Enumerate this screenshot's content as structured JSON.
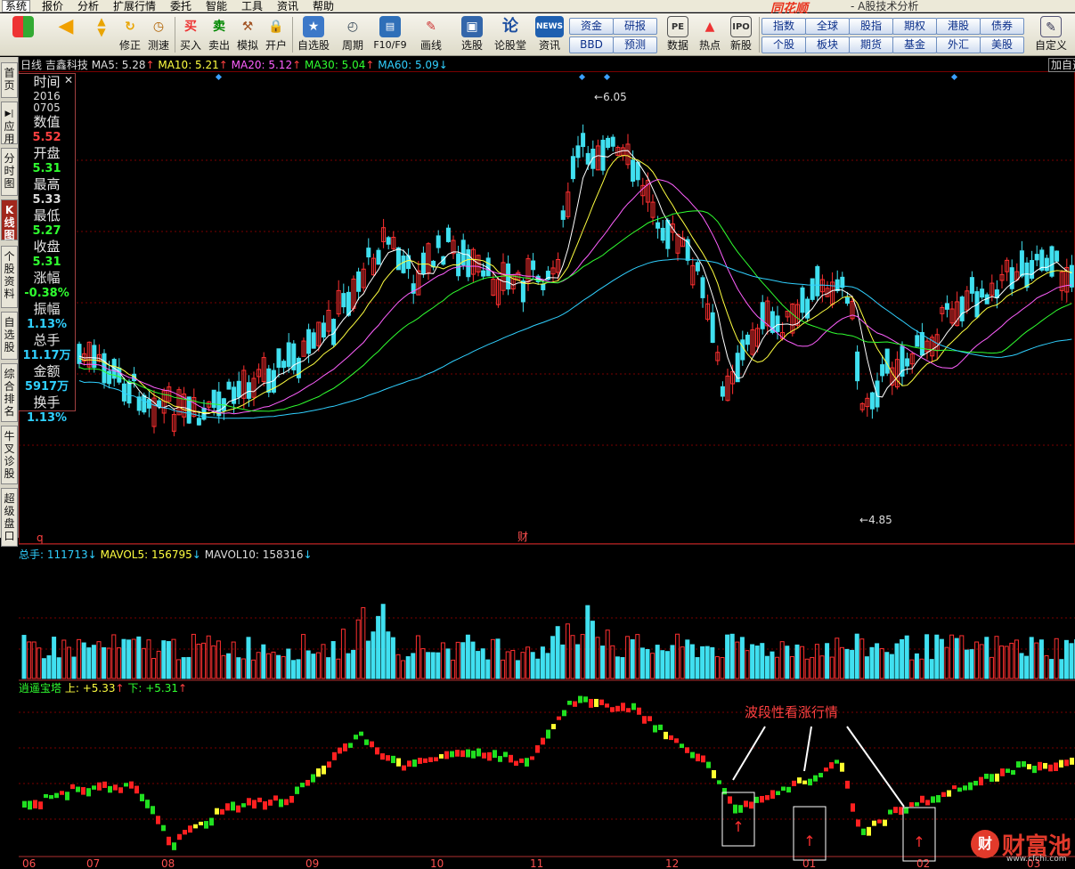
{
  "menu": {
    "items": [
      "系统",
      "报价",
      "分析",
      "扩展行情",
      "委托",
      "智能",
      "工具",
      "资讯",
      "帮助"
    ],
    "active_index": 0,
    "brand": "同花顺",
    "subtitle": "- A股技术分析"
  },
  "toolbar": {
    "buttons": [
      {
        "label": "",
        "icon": "windows-logo-icon"
      },
      {
        "label": "",
        "icon": "back-arrow-icon"
      },
      {
        "label": "修正",
        "icon": "up-down-arrow-icon"
      },
      {
        "label": "测速",
        "icon": "gauge-icon"
      },
      {
        "label": "买入",
        "icon": "buy-icon",
        "glyph": "买"
      },
      {
        "label": "卖出",
        "icon": "sell-icon",
        "glyph": "卖"
      },
      {
        "label": "模拟",
        "icon": "hammer-icon"
      },
      {
        "label": "开户",
        "icon": "lock-icon"
      },
      {
        "label": "自选股",
        "icon": "star-folder-icon"
      },
      {
        "label": "周期",
        "icon": "clock-icon"
      },
      {
        "label": "F10/F9",
        "icon": "document-icon"
      },
      {
        "label": "画线",
        "icon": "pencil-icon"
      },
      {
        "label": "选股",
        "icon": "screen-icon"
      },
      {
        "label": "论股堂",
        "icon": "forum-icon",
        "glyph": "论"
      },
      {
        "label": "资讯",
        "icon": "news-icon",
        "glyph": "NEWS"
      },
      {
        "label": "数据",
        "icon": "pe-icon",
        "glyph": "PE"
      },
      {
        "label": "热点",
        "icon": "hot-icon"
      },
      {
        "label": "新股",
        "icon": "ipo-icon"
      },
      {
        "label": "自定义",
        "icon": "customize-icon"
      }
    ],
    "pills_group1": [
      "资金",
      "研报",
      "BBD",
      "预测"
    ],
    "pills_group2": [
      "指数",
      "全球",
      "股指",
      "期权",
      "港股",
      "债券",
      "个股",
      "板块",
      "期货",
      "基金",
      "外汇",
      "美股"
    ]
  },
  "sidetabs": [
    "首页",
    "应用",
    "分时图",
    "K线图",
    "个股资料",
    "自选股",
    "综合排名",
    "牛叉诊股",
    "超级盘口"
  ],
  "sidetab_active": 3,
  "price_header": {
    "period": "日线",
    "stock": "吉鑫科技",
    "ma5": "MA5: 5.28",
    "ma10": "MA10: 5.21",
    "ma20": "MA20: 5.12",
    "ma30": "MA30: 5.04",
    "ma60": "MA60: 5.09",
    "right": "加自选"
  },
  "info_panel": {
    "time_label": "时间",
    "year": "2016",
    "date": "0705",
    "value_label": "数值",
    "value": "5.52",
    "open_label": "开盘",
    "open": "5.31",
    "high_label": "最高",
    "high": "5.33",
    "low_label": "最低",
    "low": "5.27",
    "close_label": "收盘",
    "close": "5.31",
    "change_label": "涨幅",
    "change": "-0.38%",
    "amp_label": "振幅",
    "amp": "1.13%",
    "vol_label": "总手",
    "vol": "11.17万",
    "amount_label": "金额",
    "amount": "5917万",
    "turnover_label": "换手",
    "turnover": "1.13%"
  },
  "annotations": {
    "high_label": "6.05",
    "low_label": "4.85",
    "finance_mark": "财",
    "q_mark": "q"
  },
  "volume_header": {
    "vol": "总手: 111713",
    "mavol5": "MAVOL5: 156795",
    "mavol10": "MAVOL10: 158316"
  },
  "indicator_header": {
    "name": "逍遥宝塔",
    "up": "上: +5.33",
    "down": "下: +5.31"
  },
  "indicator_note": "波段性看涨行情",
  "x_axis": [
    "06",
    "07",
    "08",
    "09",
    "10",
    "11",
    "12",
    "01",
    "02",
    "03"
  ],
  "logo": {
    "mark": "财",
    "text": "财富池",
    "url": "www.cfchi.com"
  },
  "colors": {
    "up": "#ff3030",
    "down": "#40e0f0",
    "bg": "#000000",
    "grid": "#7a0000"
  }
}
